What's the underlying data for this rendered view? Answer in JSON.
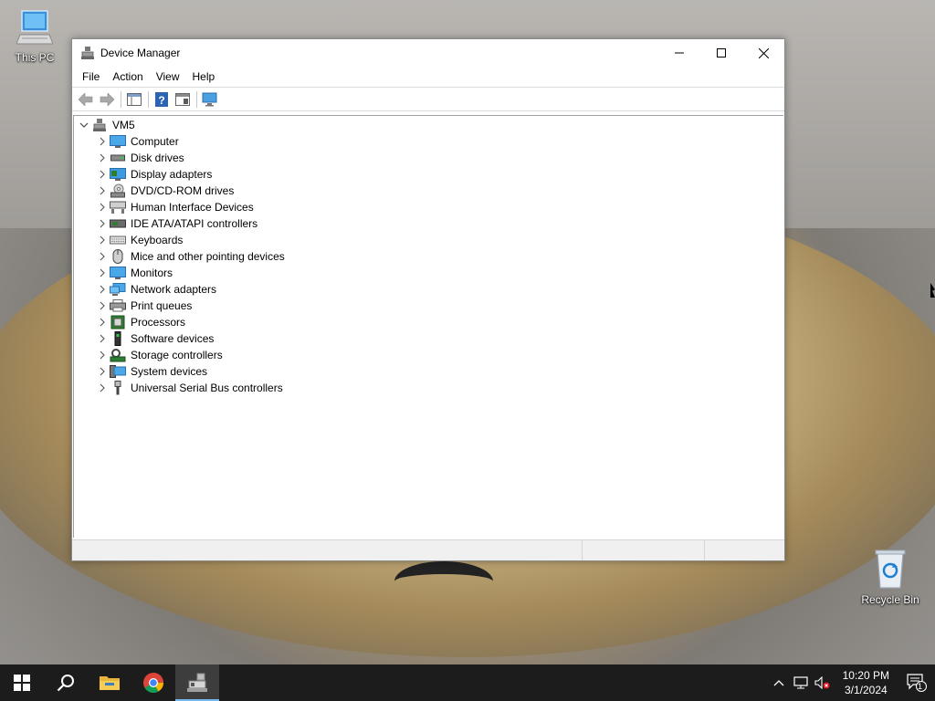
{
  "desktop": {
    "icons": [
      {
        "label": "This PC"
      },
      {
        "label": "Recycle Bin"
      }
    ]
  },
  "window": {
    "title": "Device Manager",
    "menu": [
      "File",
      "Action",
      "View",
      "Help"
    ],
    "tree": {
      "root": "VM5",
      "nodes": [
        {
          "label": "Computer",
          "icon": "computer-icon"
        },
        {
          "label": "Disk drives",
          "icon": "disk-drive-icon"
        },
        {
          "label": "Display adapters",
          "icon": "display-adapter-icon"
        },
        {
          "label": "DVD/CD-ROM drives",
          "icon": "dvd-drive-icon"
        },
        {
          "label": "Human Interface Devices",
          "icon": "hid-icon"
        },
        {
          "label": "IDE ATA/ATAPI controllers",
          "icon": "ide-controller-icon"
        },
        {
          "label": "Keyboards",
          "icon": "keyboard-icon"
        },
        {
          "label": "Mice and other pointing devices",
          "icon": "mouse-icon"
        },
        {
          "label": "Monitors",
          "icon": "monitor-icon"
        },
        {
          "label": "Network adapters",
          "icon": "network-adapter-icon"
        },
        {
          "label": "Print queues",
          "icon": "printer-icon"
        },
        {
          "label": "Processors",
          "icon": "processor-icon"
        },
        {
          "label": "Software devices",
          "icon": "software-device-icon"
        },
        {
          "label": "Storage controllers",
          "icon": "storage-controller-icon"
        },
        {
          "label": "System devices",
          "icon": "system-device-icon"
        },
        {
          "label": "Universal Serial Bus controllers",
          "icon": "usb-icon"
        }
      ]
    }
  },
  "taskbar": {
    "clock_time": "10:20 PM",
    "clock_date": "3/1/2024",
    "notification_count": "1"
  },
  "colors": {
    "taskbar": "#1c1c1c",
    "accent": "#76b9ed"
  }
}
